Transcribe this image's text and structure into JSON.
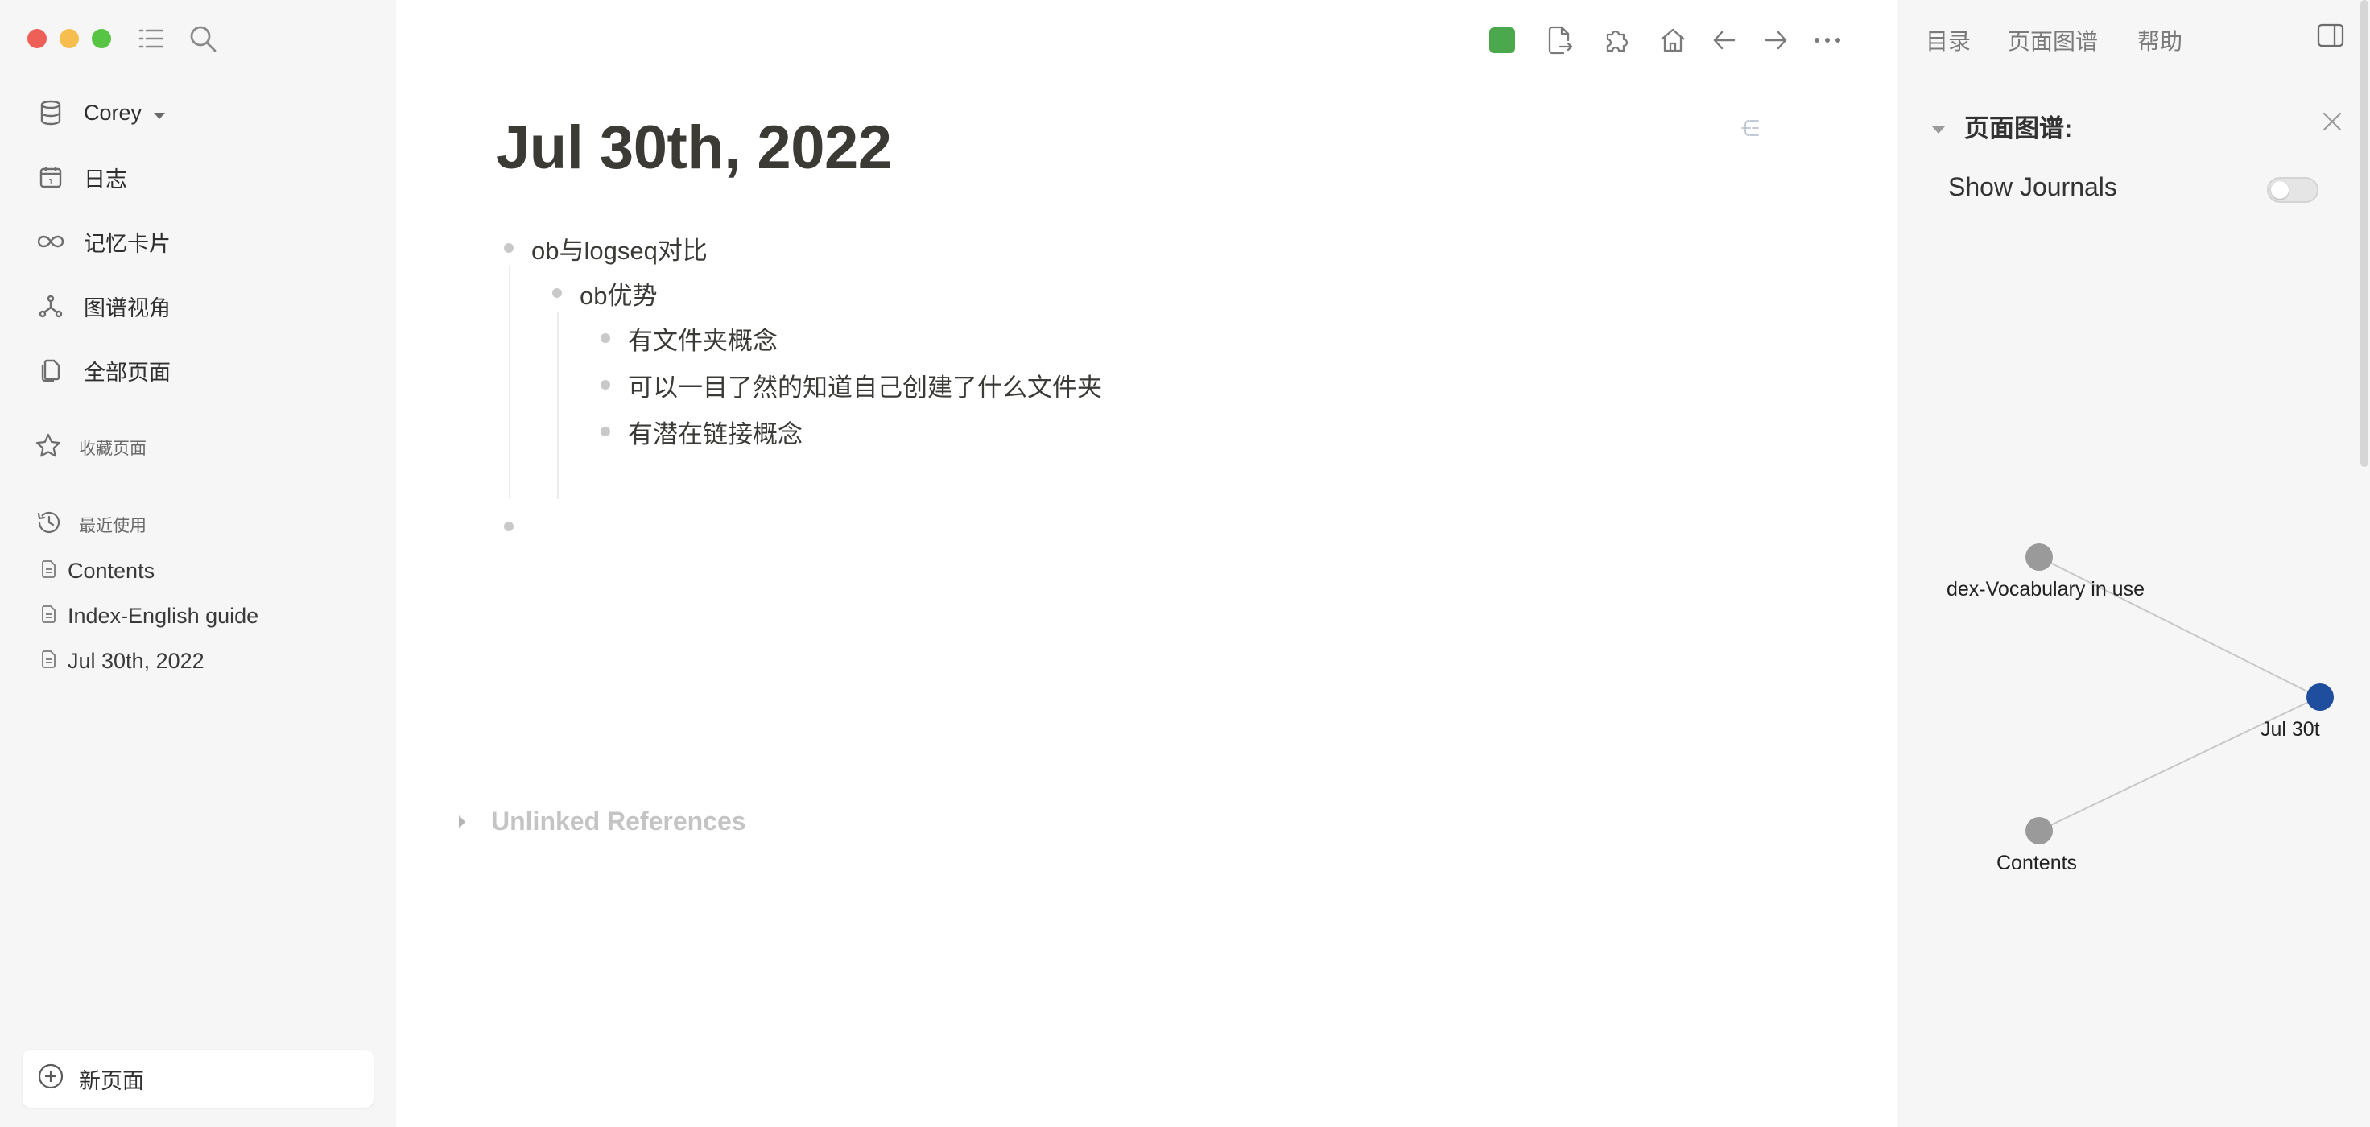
{
  "sidebar": {
    "graph_name": "Corey",
    "nav": [
      {
        "label": "日志",
        "icon": "calendar-icon"
      },
      {
        "label": "记忆卡片",
        "icon": "infinity-icon"
      },
      {
        "label": "图谱视角",
        "icon": "graph-icon"
      },
      {
        "label": "全部页面",
        "icon": "pages-icon"
      }
    ],
    "favorites_label": "收藏页面",
    "recent_label": "最近使用",
    "recent": [
      "Contents",
      "Index-English guide",
      "Jul 30th, 2022"
    ],
    "new_page_label": "新页面"
  },
  "toolbar": {
    "sync_color": "#4ca84c",
    "icons": [
      "export-icon",
      "plugin-icon",
      "home-icon",
      "back-arrow-icon",
      "forward-arrow-icon",
      "more-icon"
    ]
  },
  "page": {
    "title": "Jul 30th, 2022",
    "blocks": {
      "b1": "ob与logseq对比",
      "b2": "ob优势",
      "b3": "有文件夹概念",
      "b4": "可以一目了然的知道自己创建了什么文件夹",
      "b5": "有潜在链接概念"
    },
    "unlinked_label": "Unlinked References"
  },
  "right_panel": {
    "tabs": [
      "目录",
      "页面图谱",
      "帮助"
    ],
    "graph_header": "页面图谱:",
    "show_journals_label": "Show Journals",
    "show_journals_on": false,
    "nodes": {
      "n1": "dex-Vocabulary in use",
      "n2": "Jul 30t",
      "n3": "Contents"
    },
    "current_node_color": "#1f4e9e",
    "node_color": "#9a9a9a"
  }
}
